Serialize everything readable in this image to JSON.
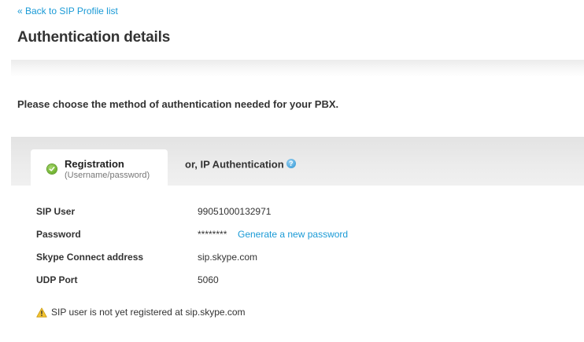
{
  "nav": {
    "back_link": "« Back to SIP Profile list"
  },
  "header": {
    "title": "Authentication details"
  },
  "intro_text": "Please choose the method of authentication needed for your PBX.",
  "tabs": [
    {
      "label": "Registration",
      "sublabel": "(Username/password)",
      "active": true,
      "icon": "check-circle-icon"
    },
    {
      "label": "or, IP Authentication",
      "active": false,
      "icon": "help-icon",
      "icon_text": "?"
    }
  ],
  "details": {
    "sip_user": {
      "label": "SIP User",
      "value": "99051000132971"
    },
    "password": {
      "label": "Password",
      "value": "********",
      "action_link": "Generate a new password"
    },
    "skype_connect_address": {
      "label": "Skype Connect address",
      "value": "sip.skype.com"
    },
    "udp_port": {
      "label": "UDP Port",
      "value": "5060"
    }
  },
  "status": {
    "icon": "warning-icon",
    "text": "SIP user is not yet registered at sip.skype.com"
  },
  "colors": {
    "link": "#1a9ad6",
    "check": "#6fb22e",
    "help": "#4aa6dd",
    "warning": "#f2c230"
  }
}
